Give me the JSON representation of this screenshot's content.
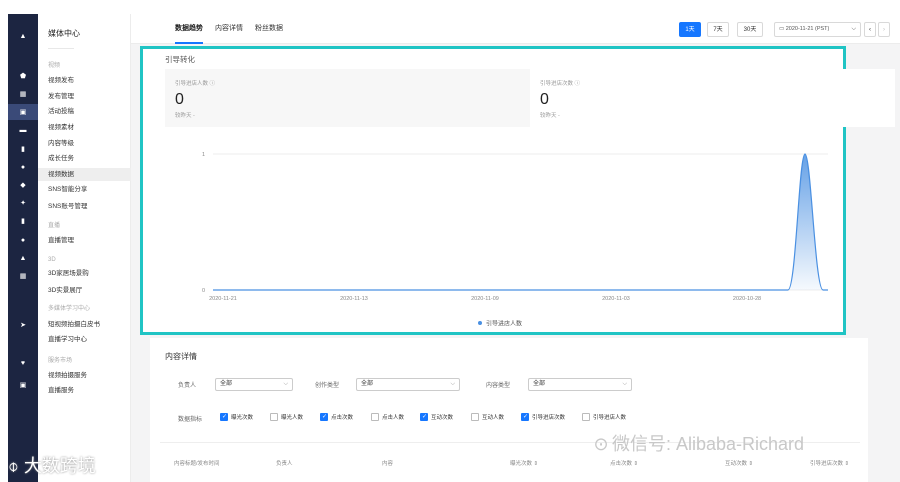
{
  "rail": [
    {
      "icon": "home-icon",
      "glyph": "▲",
      "active": false
    },
    {
      "icon": "shield-icon",
      "glyph": "⬟",
      "active": false,
      "badge": true
    },
    {
      "icon": "grid-icon",
      "glyph": "▦",
      "active": false
    },
    {
      "icon": "media-icon",
      "glyph": "▣",
      "active": true,
      "badge": true
    },
    {
      "icon": "comment-icon",
      "glyph": "▬",
      "active": false
    },
    {
      "icon": "bar-chart-icon",
      "glyph": "▮",
      "active": false
    },
    {
      "icon": "bulb-icon",
      "glyph": "●",
      "active": false
    },
    {
      "icon": "people-icon",
      "glyph": "◆",
      "active": false
    },
    {
      "icon": "compass-icon",
      "glyph": "✦",
      "active": false
    },
    {
      "icon": "document-icon",
      "glyph": "▮",
      "active": false
    },
    {
      "icon": "globe-icon",
      "glyph": "●",
      "active": false
    },
    {
      "icon": "bell-icon",
      "glyph": "▲",
      "active": false
    },
    {
      "icon": "bank-icon",
      "glyph": "▦",
      "active": false
    },
    {
      "icon": "send-icon",
      "glyph": "➤",
      "active": false
    },
    {
      "icon": "heart-icon",
      "glyph": "♥",
      "active": false
    },
    {
      "icon": "store-icon",
      "glyph": "▣",
      "active": false
    }
  ],
  "menu": {
    "title": "媒体中心",
    "items": [
      {
        "label": "视频",
        "group": true
      },
      {
        "label": "视频发布"
      },
      {
        "label": "发布管理"
      },
      {
        "label": "活动投稿"
      },
      {
        "label": "视频素材"
      },
      {
        "label": "内容等级"
      },
      {
        "label": "成长任务"
      },
      {
        "label": "视频数据",
        "active": true
      },
      {
        "label": "SNS智能分享"
      },
      {
        "label": "SNS账号管理"
      },
      {
        "label": "直播",
        "group": true
      },
      {
        "label": "直播管理"
      },
      {
        "label": "3D",
        "group": true
      },
      {
        "label": "3D家居场景购"
      },
      {
        "label": "3D实景展厅"
      },
      {
        "label": "多媒体学习中心",
        "group": true
      },
      {
        "label": "短视频拍摄白皮书"
      },
      {
        "label": "直播学习中心"
      },
      {
        "label": "服务市场",
        "group": true
      },
      {
        "label": "视频拍摄服务"
      },
      {
        "label": "直播服务"
      }
    ]
  },
  "topbar": {
    "tabs": [
      {
        "label": "数据趋势",
        "active": true
      },
      {
        "label": "内容详情"
      },
      {
        "label": "粉丝数据"
      }
    ],
    "ranges": [
      "1天",
      "7天",
      "30天"
    ],
    "date": "2020-11-21 (PST)",
    "prev": "‹",
    "next": "›"
  },
  "convert": {
    "title": "引导转化",
    "metrics": [
      {
        "label": "引导进店人数",
        "value": "0",
        "compare": "较昨天 -"
      },
      {
        "label": "引导进店次数",
        "value": "0",
        "compare": "较昨天 -"
      }
    ]
  },
  "chart_data": {
    "type": "line",
    "x": [
      "2020-11-21",
      "2020-11-13",
      "2020-11-09",
      "2020-11-03",
      "2020-10-28"
    ],
    "series": [
      {
        "name": "引导进店人数",
        "values": [
          0,
          0,
          0,
          0,
          0,
          1,
          0
        ]
      }
    ],
    "yticks": [
      "1",
      "0"
    ],
    "ylim": [
      0,
      1
    ],
    "legend": "bottom-center",
    "color": "#4a90e2"
  },
  "detail": {
    "title": "内容详情",
    "filters": [
      {
        "label": "负责人",
        "value": "全部"
      },
      {
        "label": "创作类型",
        "value": "全部"
      },
      {
        "label": "内容类型",
        "value": "全部"
      }
    ],
    "metrics_label": "数据指标",
    "checkboxes": [
      {
        "label": "曝光次数",
        "checked": true
      },
      {
        "label": "曝光人数",
        "checked": false
      },
      {
        "label": "点击次数",
        "checked": true
      },
      {
        "label": "点击人数",
        "checked": false
      },
      {
        "label": "互动次数",
        "checked": true
      },
      {
        "label": "互动人数",
        "checked": false
      },
      {
        "label": "引导进店次数",
        "checked": true
      },
      {
        "label": "引导进店人数",
        "checked": false
      }
    ],
    "columns": [
      "内容标题/发布时间",
      "负责人",
      "内容",
      "曝光次数 ⇕",
      "点击次数 ⇕",
      "互动次数 ⇕",
      "引导进店次数 ⇕"
    ]
  },
  "watermarks": {
    "wechat": "微信号: Alibaba-Richard",
    "brand": "大数跨境"
  }
}
